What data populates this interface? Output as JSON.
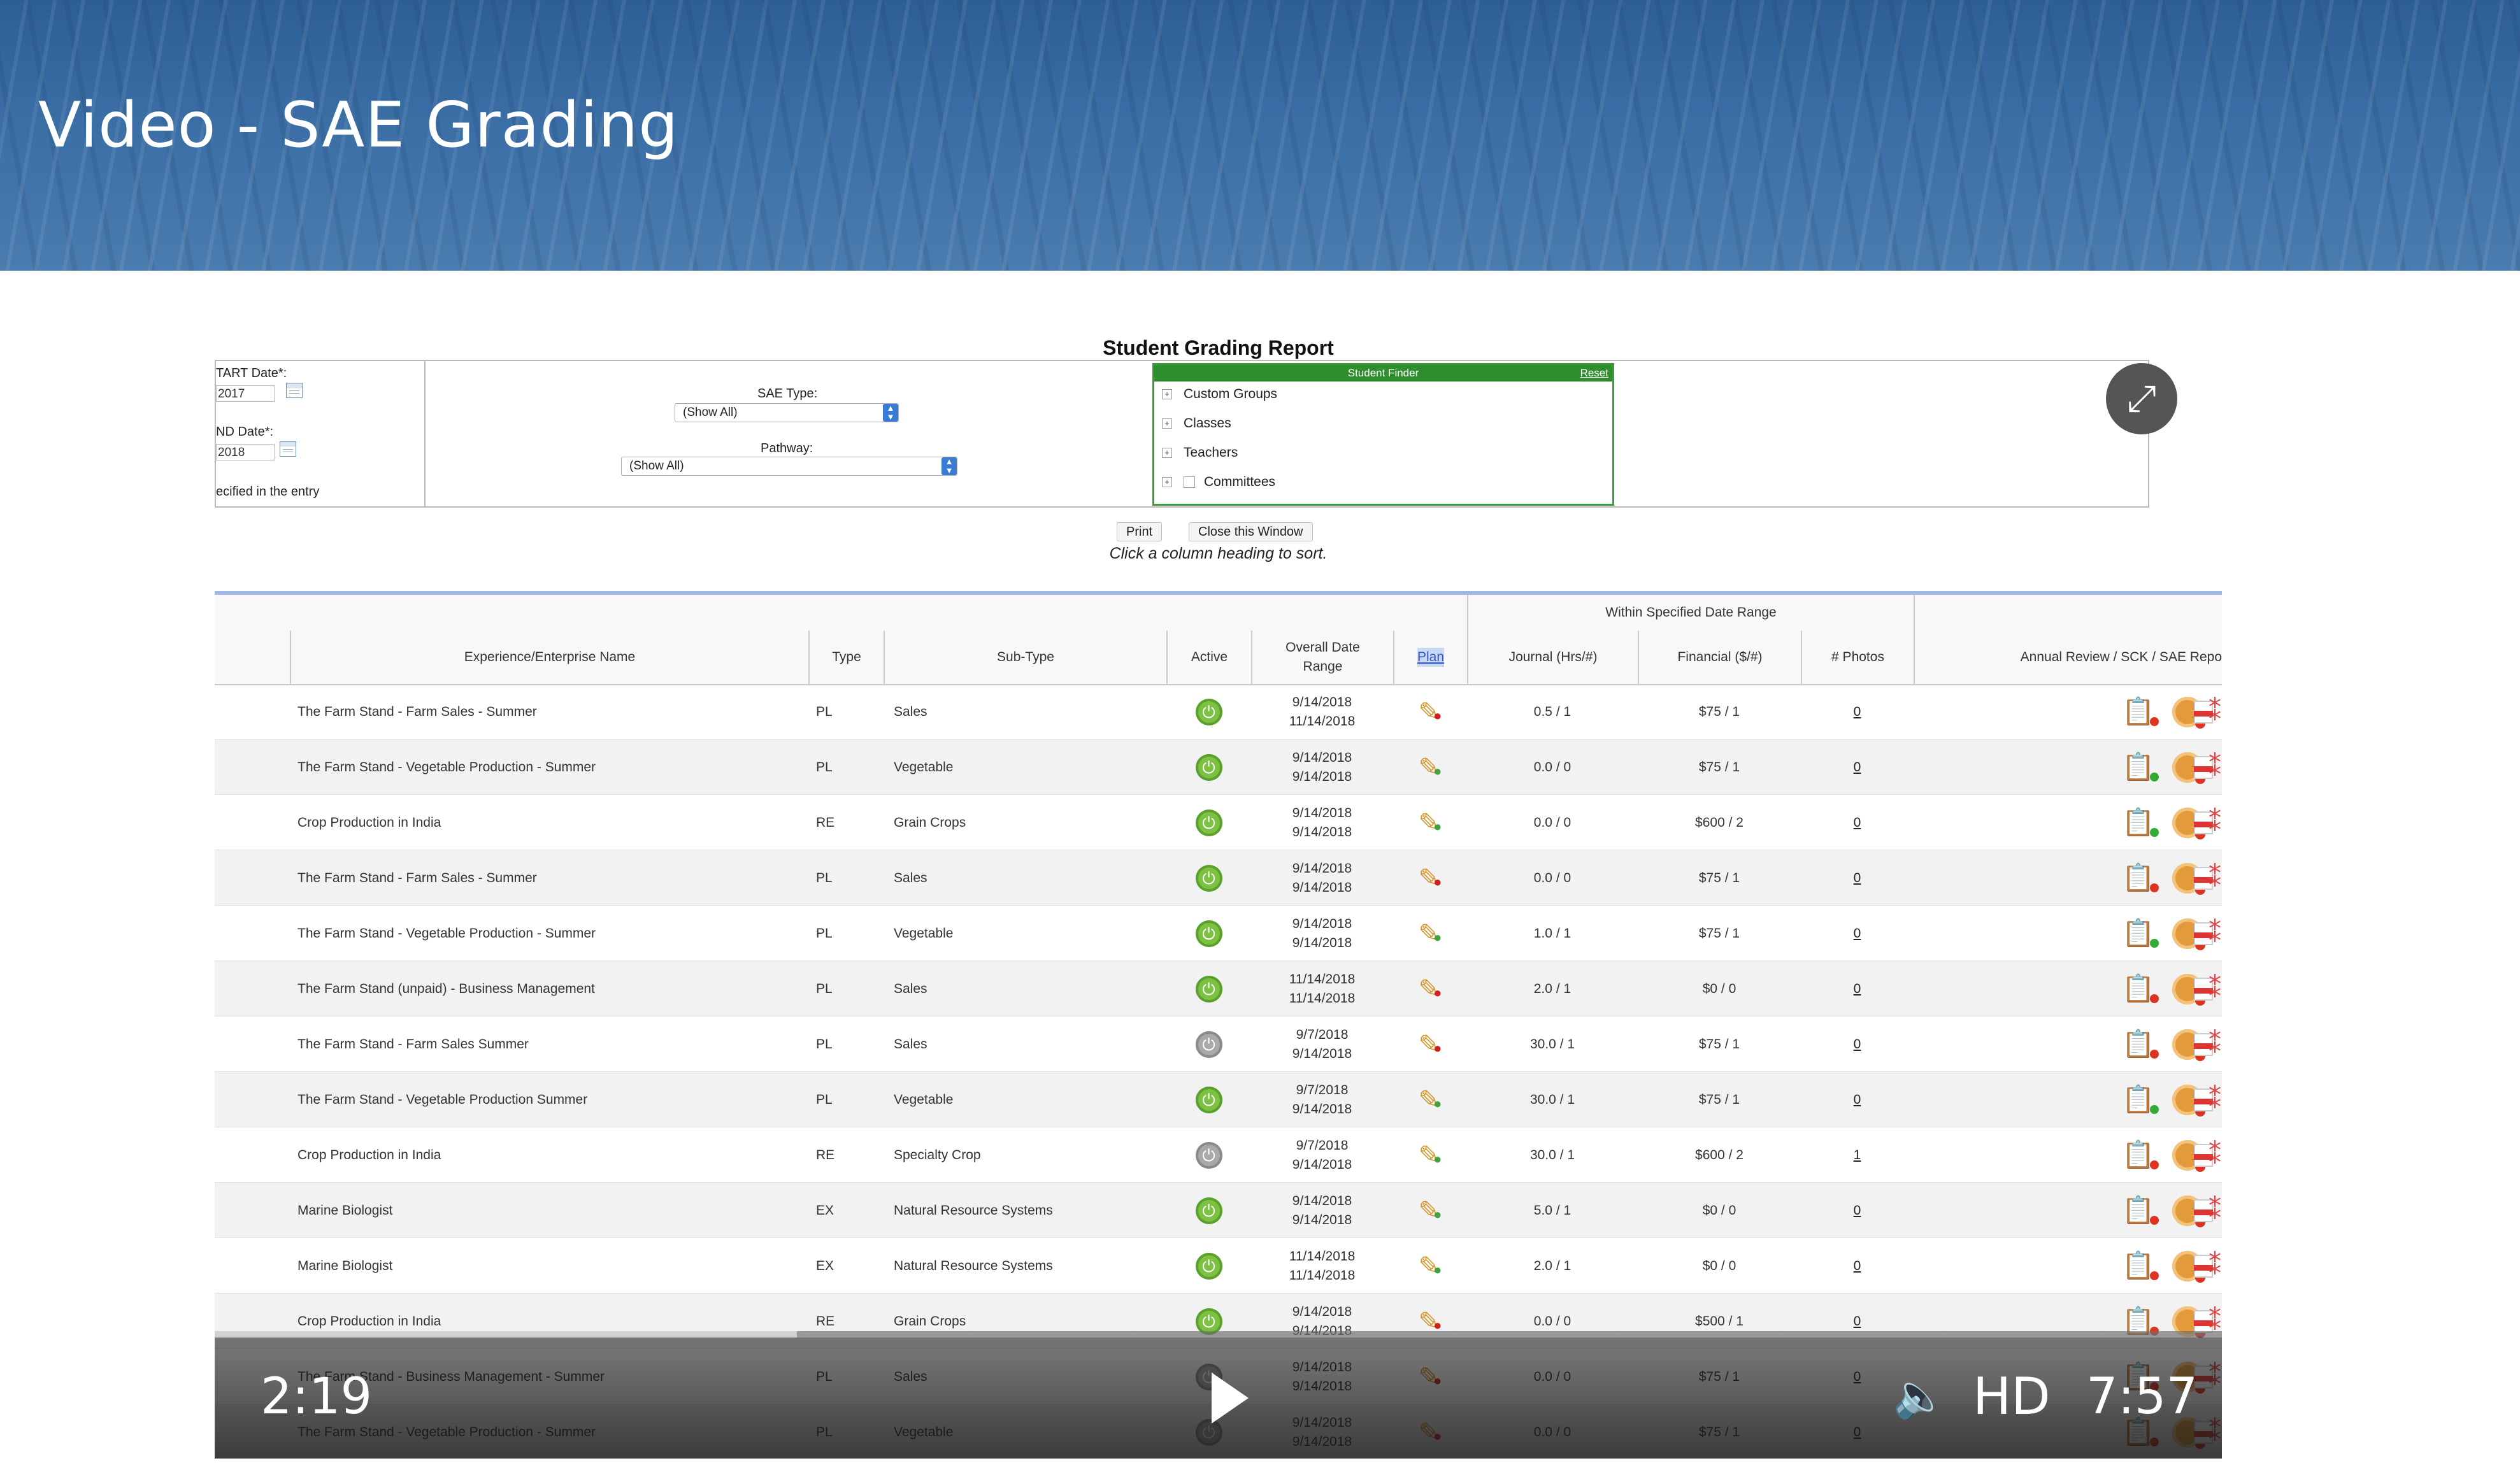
{
  "banner": {
    "title": "Video - SAE Grading"
  },
  "report": {
    "title": "Student Grading Report",
    "start_date_label": "TART Date*:",
    "start_date_value": "2017",
    "end_date_label": "ND Date*:",
    "end_date_value": "2018",
    "specified_note": "ecified in the entry",
    "sae_type_label": "SAE Type:",
    "sae_type_value": "(Show All)",
    "pathway_label": "Pathway:",
    "pathway_value": "(Show All)",
    "finder": {
      "title": "Student Finder",
      "reset": "Reset",
      "items": [
        "Custom Groups",
        "Classes",
        "Teachers",
        "Committees"
      ]
    },
    "print_label": "Print",
    "close_label": "Close this Window",
    "hint": "Click a column heading to sort."
  },
  "grid": {
    "group_header": "Within Specified Date Range",
    "columns": {
      "name": "Experience/Enterprise Name",
      "type": "Type",
      "subtype": "Sub-Type",
      "active": "Active",
      "date_range": "Overall Date Range",
      "plan": "Plan",
      "journal": "Journal (Hrs/#)",
      "financial": "Financial ($/#)",
      "photos": "# Photos",
      "annual": "Annual Review / SCK / SAE Repo"
    },
    "rows": [
      {
        "name": "The Farm Stand - Farm Sales - Summer",
        "type": "PL",
        "subtype": "Sales",
        "active": "on",
        "d1": "9/14/2018",
        "d2": "11/14/2018",
        "plan_mark": "red",
        "journal": "0.5 / 1",
        "financial": "$75 / 1",
        "photos": "0",
        "clip": "dark"
      },
      {
        "name": "The Farm Stand - Vegetable Production - Summer",
        "type": "PL",
        "subtype": "Vegetable",
        "active": "on",
        "d1": "9/14/2018",
        "d2": "9/14/2018",
        "plan_mark": "green",
        "journal": "0.0 / 0",
        "financial": "$75 / 1",
        "photos": "0",
        "clip": "light"
      },
      {
        "name": "Crop Production in India",
        "type": "RE",
        "subtype": "Grain Crops",
        "active": "on",
        "d1": "9/14/2018",
        "d2": "9/14/2018",
        "plan_mark": "green",
        "journal": "0.0 / 0",
        "financial": "$600 / 2",
        "photos": "0",
        "clip": "light"
      },
      {
        "name": "The Farm Stand - Farm Sales - Summer",
        "type": "PL",
        "subtype": "Sales",
        "active": "on",
        "d1": "9/14/2018",
        "d2": "9/14/2018",
        "plan_mark": "red",
        "journal": "0.0 / 0",
        "financial": "$75 / 1",
        "photos": "0",
        "clip": "dark"
      },
      {
        "name": "The Farm Stand - Vegetable Production - Summer",
        "type": "PL",
        "subtype": "Vegetable",
        "active": "on",
        "d1": "9/14/2018",
        "d2": "9/14/2018",
        "plan_mark": "green",
        "journal": "1.0 / 1",
        "financial": "$75 / 1",
        "photos": "0",
        "clip": "light"
      },
      {
        "name": "The Farm Stand (unpaid) - Business Management",
        "type": "PL",
        "subtype": "Sales",
        "active": "on",
        "d1": "11/14/2018",
        "d2": "11/14/2018",
        "plan_mark": "red",
        "journal": "2.0 / 1",
        "financial": "$0 / 0",
        "photos": "0",
        "clip": "dark"
      },
      {
        "name": "The Farm Stand - Farm Sales Summer",
        "type": "PL",
        "subtype": "Sales",
        "active": "off",
        "d1": "9/7/2018",
        "d2": "9/14/2018",
        "plan_mark": "red",
        "journal": "30.0 / 1",
        "financial": "$75 / 1",
        "photos": "0",
        "clip": "dark"
      },
      {
        "name": "The Farm Stand - Vegetable Production Summer",
        "type": "PL",
        "subtype": "Vegetable",
        "active": "on",
        "d1": "9/7/2018",
        "d2": "9/14/2018",
        "plan_mark": "green",
        "journal": "30.0 / 1",
        "financial": "$75 / 1",
        "photos": "0",
        "clip": "light"
      },
      {
        "name": "Crop Production in India",
        "type": "RE",
        "subtype": "Specialty Crop",
        "active": "off",
        "d1": "9/7/2018",
        "d2": "9/14/2018",
        "plan_mark": "green",
        "journal": "30.0 / 1",
        "financial": "$600 / 2",
        "photos": "1",
        "clip": "dark"
      },
      {
        "name": "Marine Biologist",
        "type": "EX",
        "subtype": "Natural Resource Systems",
        "active": "on",
        "d1": "9/14/2018",
        "d2": "9/14/2018",
        "plan_mark": "green",
        "journal": "5.0 / 1",
        "financial": "$0 / 0",
        "photos": "0",
        "clip": "dark"
      },
      {
        "name": "Marine Biologist",
        "type": "EX",
        "subtype": "Natural Resource Systems",
        "active": "on",
        "d1": "11/14/2018",
        "d2": "11/14/2018",
        "plan_mark": "green",
        "journal": "2.0 / 1",
        "financial": "$0 / 0",
        "photos": "0",
        "clip": "dark"
      },
      {
        "name": "Crop Production in India",
        "type": "RE",
        "subtype": "Grain Crops",
        "active": "on",
        "d1": "9/14/2018",
        "d2": "9/14/2018",
        "plan_mark": "red",
        "journal": "0.0 / 0",
        "financial": "$500 / 1",
        "photos": "0",
        "clip": "dark"
      },
      {
        "name": "The Farm Stand - Business Management - Summer",
        "type": "PL",
        "subtype": "Sales",
        "active": "off",
        "d1": "9/14/2018",
        "d2": "9/14/2018",
        "plan_mark": "red",
        "journal": "0.0 / 0",
        "financial": "$75 / 1",
        "photos": "0",
        "clip": "dark"
      },
      {
        "name": "The Farm Stand - Vegetable Production - Summer",
        "type": "PL",
        "subtype": "Vegetable",
        "active": "off",
        "d1": "9/14/2018",
        "d2": "9/14/2018",
        "plan_mark": "red",
        "journal": "0.0 / 0",
        "financial": "$75 / 1",
        "photos": "0",
        "clip": "dark"
      }
    ]
  },
  "player": {
    "current_time": "2:19",
    "duration": "7:57",
    "quality": "HD",
    "progress_fraction": 0.29
  },
  "colors": {
    "banner": "#3a6ea5",
    "finder_green": "#2f8f2f",
    "active_green": "#7dc142",
    "active_grey": "#a9a9a9"
  }
}
